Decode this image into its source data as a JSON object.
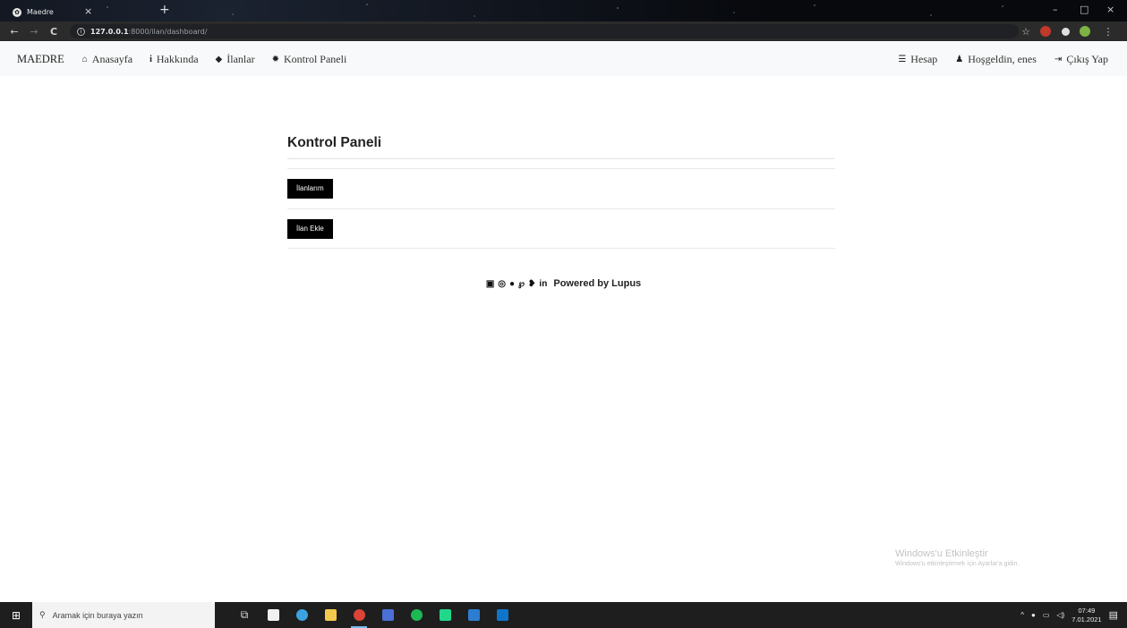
{
  "browser": {
    "tab_title": "Maedre",
    "tab_close": "×",
    "new_tab": "+",
    "url_host": "127.0.0.1",
    "url_rest": ":8000/ilan/dashboard/",
    "nav_back": "←",
    "nav_forward": "→",
    "nav_reload": "C",
    "min": "–",
    "max": "□",
    "close": "×",
    "star": "☆"
  },
  "navbar": {
    "brand": "MAEDRE",
    "links": [
      {
        "label": "Anasayfa",
        "icon": "home-icon"
      },
      {
        "label": "Hakkında",
        "icon": "info-icon"
      },
      {
        "label": "İlanlar",
        "icon": "tag-icon"
      },
      {
        "label": "Kontrol Paneli",
        "icon": "gear-icon"
      }
    ],
    "right": [
      {
        "label": "Hesap",
        "icon": "menu-icon"
      },
      {
        "label": "Hoşgeldin, enes",
        "icon": "user-icon"
      },
      {
        "label": "Çıkış Yap",
        "icon": "sign-out-icon"
      }
    ]
  },
  "panel": {
    "title": "Kontrol Paneli",
    "buttons": [
      "İlanlarım",
      "İlan Ekle"
    ]
  },
  "footer": {
    "text": "Powered by Lupus",
    "social_icons": [
      "facebook-icon",
      "instagram-icon",
      "opera-icon",
      "pinterest-icon",
      "twitter-icon",
      "linkedin-icon"
    ]
  },
  "watermark": {
    "line1": "Windows'u Etkinleştir",
    "line2": "Windows'u etkinleştirmek için Ayarlar'a gidin."
  },
  "taskbar": {
    "search_placeholder": "Aramak için buraya yazın",
    "time": "07:49",
    "date": "7.01.2021"
  },
  "colors": {
    "navbar_bg": "#f8f9fa",
    "button_bg": "#000000",
    "taskbar_bg": "#1e1e1e"
  }
}
